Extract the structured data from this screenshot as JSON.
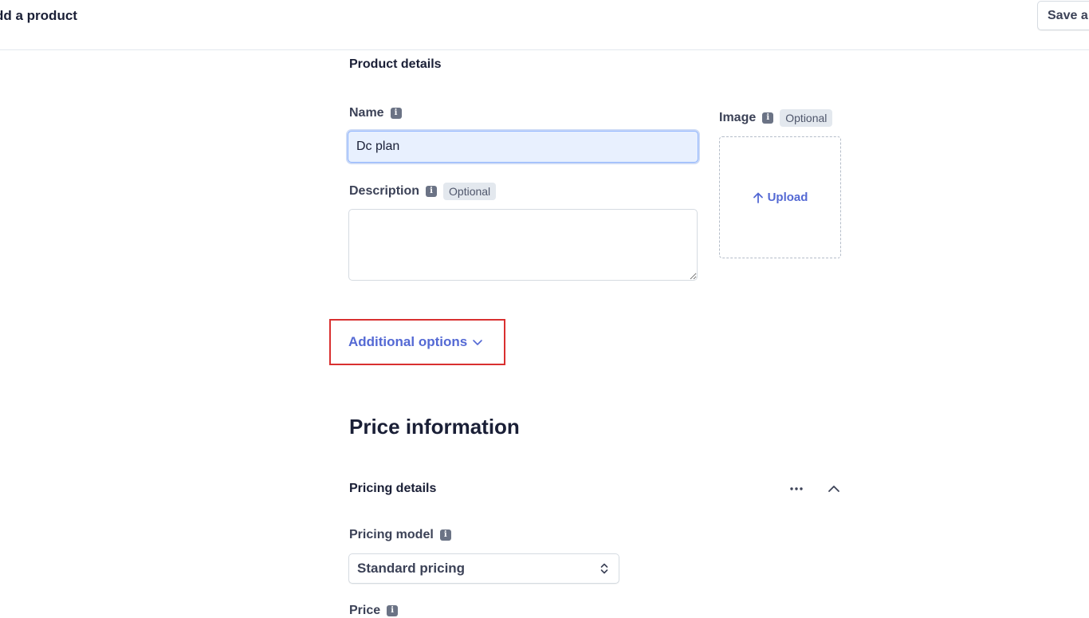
{
  "header": {
    "title": "dd a product",
    "save_label": "Save a"
  },
  "product_details": {
    "section_title": "Product details",
    "name": {
      "label": "Name",
      "value": "Dc plan"
    },
    "description": {
      "label": "Description",
      "optional_badge": "Optional",
      "value": ""
    },
    "image": {
      "label": "Image",
      "optional_badge": "Optional",
      "upload_label": "Upload"
    },
    "additional_options_label": "Additional options"
  },
  "price_information": {
    "title": "Price information",
    "pricing_details": {
      "title": "Pricing details"
    },
    "pricing_model": {
      "label": "Pricing model",
      "selected": "Standard pricing"
    },
    "price": {
      "label": "Price"
    }
  },
  "colors": {
    "accent": "#5469d4",
    "highlight_border": "#d93030",
    "autofill_background": "#e8f0fe"
  },
  "icons": [
    "info-icon",
    "upload-arrow-icon",
    "chevron-down-icon",
    "ellipsis-icon",
    "chevron-up-icon",
    "select-updown-icon"
  ]
}
